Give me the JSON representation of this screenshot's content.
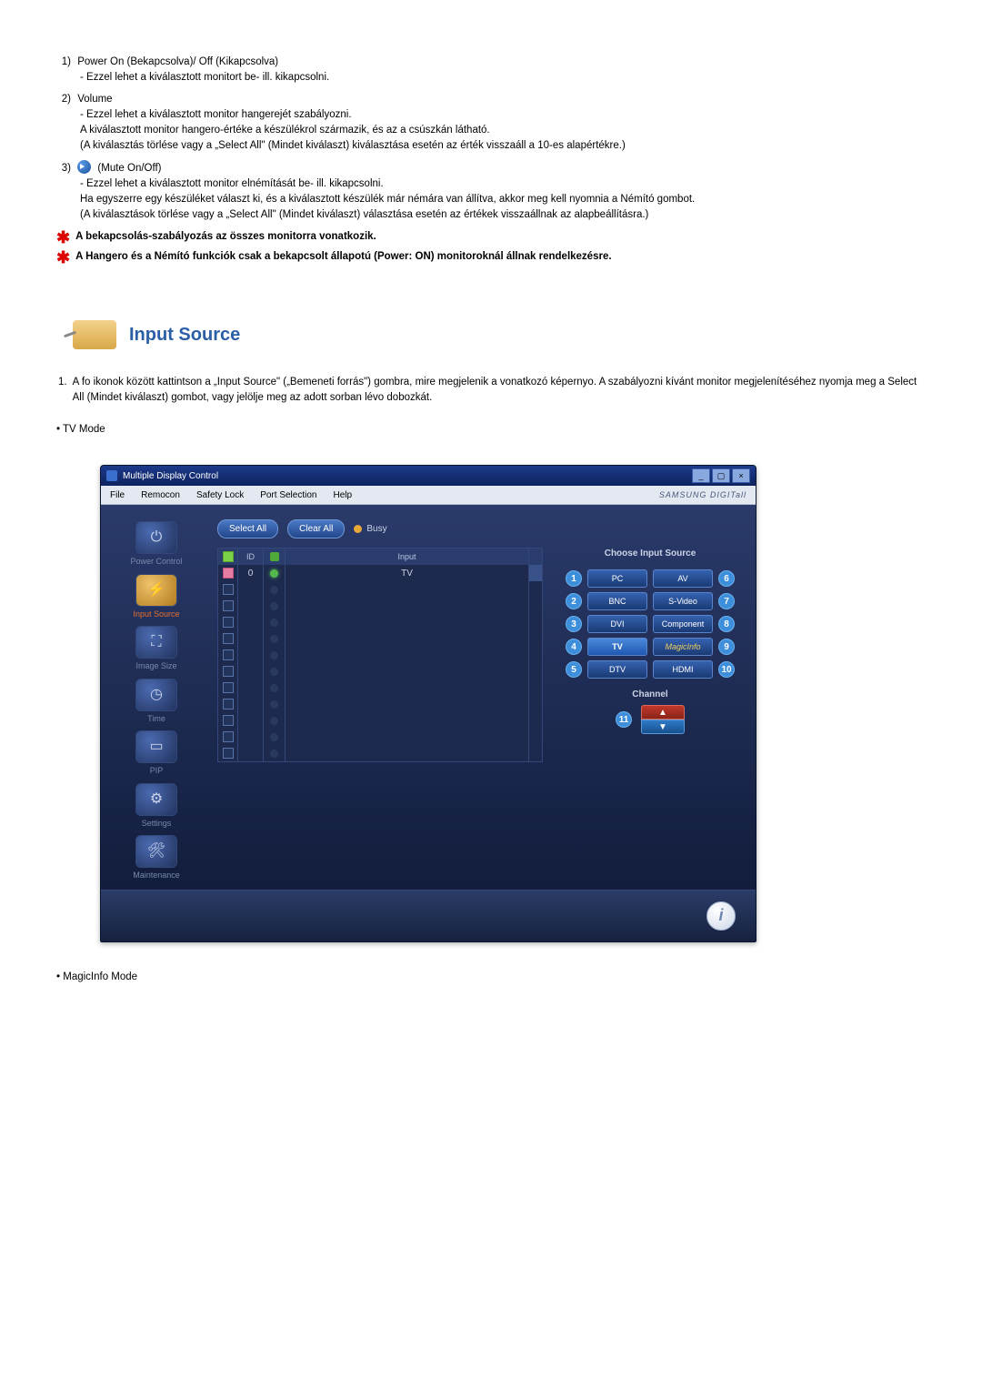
{
  "list": {
    "i1": {
      "num": "1)",
      "title": "Power On (Bekapcsolva)/ Off (Kikapcsolva)",
      "d1": "- Ezzel lehet a kiválasztott monitort be- ill. kikapcsolni."
    },
    "i2": {
      "num": "2)",
      "title": "Volume",
      "d1": "- Ezzel lehet a kiválasztott monitor hangerejét szabályozni.",
      "d2": "A kiválasztott monitor hangero-értéke a készülékrol származik, és az a csúszkán látható.",
      "d3": "(A kiválasztás törlése vagy a „Select All\" (Mindet kiválaszt) kiválasztása esetén az érték visszaáll a 10-es alapértékre.)"
    },
    "i3": {
      "num": "3)",
      "title": "(Mute On/Off)",
      "d1": "- Ezzel lehet a kiválasztott monitor elnémítását be- ill. kikapcsolni.",
      "d2": "Ha egyszerre egy készüléket választ ki, és a kiválasztott készülék már némára van állítva, akkor meg kell nyomnia a Némító gombot.",
      "d3": "(A kiválasztások törlése vagy a „Select All\" (Mindet kiválaszt) választása esetén az értékek visszaállnak az alapbeállításra.)"
    }
  },
  "star1": "A bekapcsolás-szabályozás az összes monitorra vonatkozik.",
  "star2": "A Hangero és a Némító funkciók csak a bekapcsolt állapotú (Power: ON) monitoroknál állnak rendelkezésre.",
  "section": {
    "title": "Input Source",
    "p1_num": "1.",
    "p1": "A fo ikonok között kattintson a „Input Source\" („Bemeneti forrás\") gombra, mire megjelenik a vonatkozó képernyo. A szabályozni kívánt monitor megjelenítéséhez nyomja meg a Select All (Mindet kiválaszt) gombot, vagy jelölje meg az adott sorban lévo dobozkát.",
    "bullet1": "TV Mode",
    "bullet2": "MagicInfo Mode"
  },
  "win": {
    "title": "Multiple Display Control",
    "menu": {
      "file": "File",
      "remocon": "Remocon",
      "safety": "Safety Lock",
      "port": "Port Selection",
      "help": "Help",
      "brand": "SAMSUNG DIGITall"
    },
    "side": {
      "power": "Power Control",
      "input": "Input Source",
      "image": "Image Size",
      "time": "Time",
      "pip": "PIP",
      "settings": "Settings",
      "maint": "Maintenance"
    },
    "btn_select": "Select All",
    "btn_clear": "Clear All",
    "busy": "Busy",
    "th_id": "ID",
    "th_input": "Input",
    "row_id": "0",
    "row_input": "TV",
    "right_title": "Choose Input Source",
    "src": {
      "pc": "PC",
      "av": "AV",
      "bnc": "BNC",
      "svideo": "S-Video",
      "dvi": "DVI",
      "comp": "Component",
      "tv": "TV",
      "mi": "MagicInfo",
      "dtv": "DTV",
      "hdmi": "HDMI"
    },
    "n": {
      "n1": "1",
      "n2": "2",
      "n3": "3",
      "n4": "4",
      "n5": "5",
      "n6": "6",
      "n7": "7",
      "n8": "8",
      "n9": "9",
      "n10": "10",
      "n11": "11"
    },
    "channel": "Channel"
  }
}
